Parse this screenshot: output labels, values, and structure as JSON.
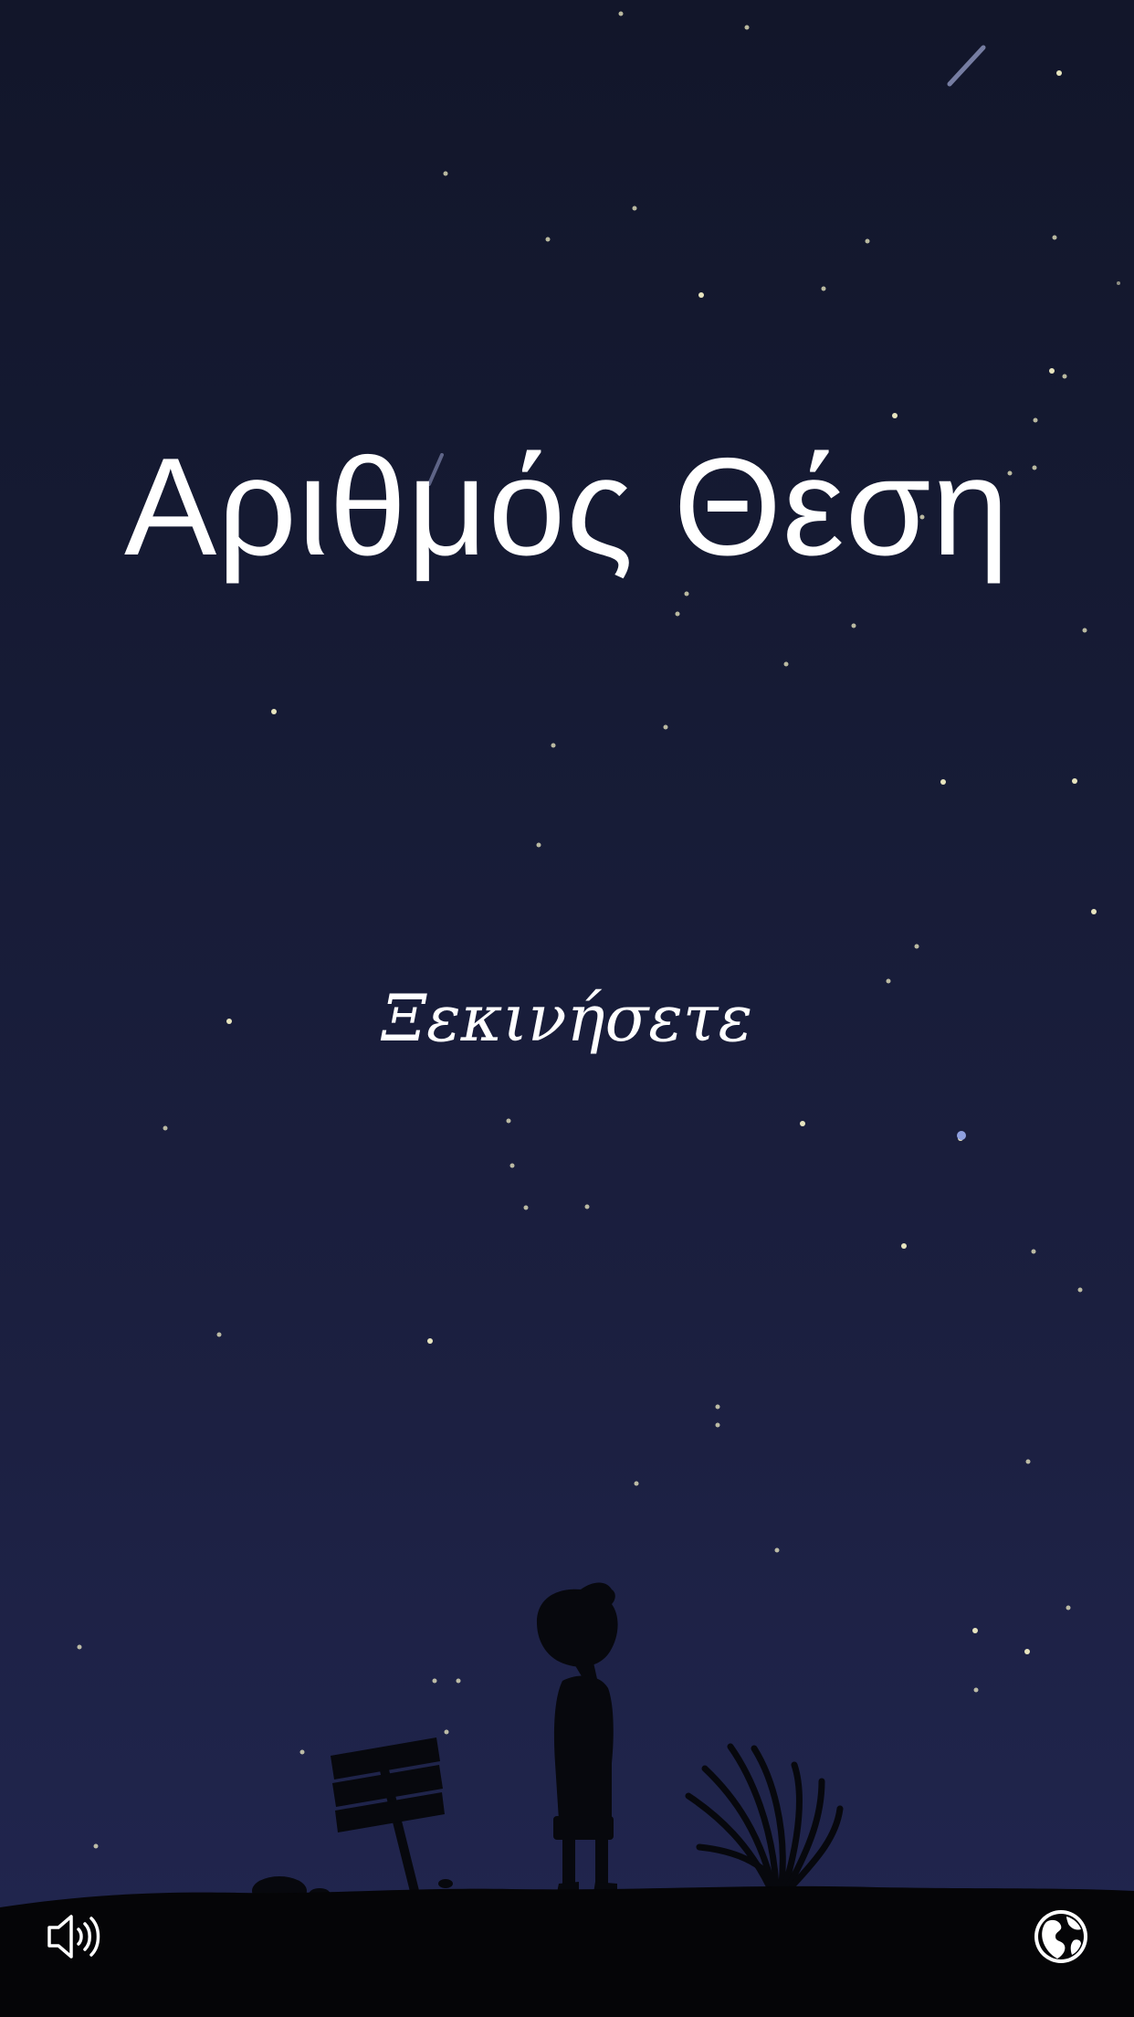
{
  "game": {
    "title": "Αριθμός Θέση",
    "start_label": "Ξεκινήσετε"
  },
  "icons": {
    "sound": "speaker-volume-icon",
    "language": "globe-icon"
  },
  "colors": {
    "sky_top": "#12162a",
    "sky_bottom": "#212650",
    "text": "#ffffff",
    "star": "#f2efc6",
    "ground": "#050507"
  }
}
